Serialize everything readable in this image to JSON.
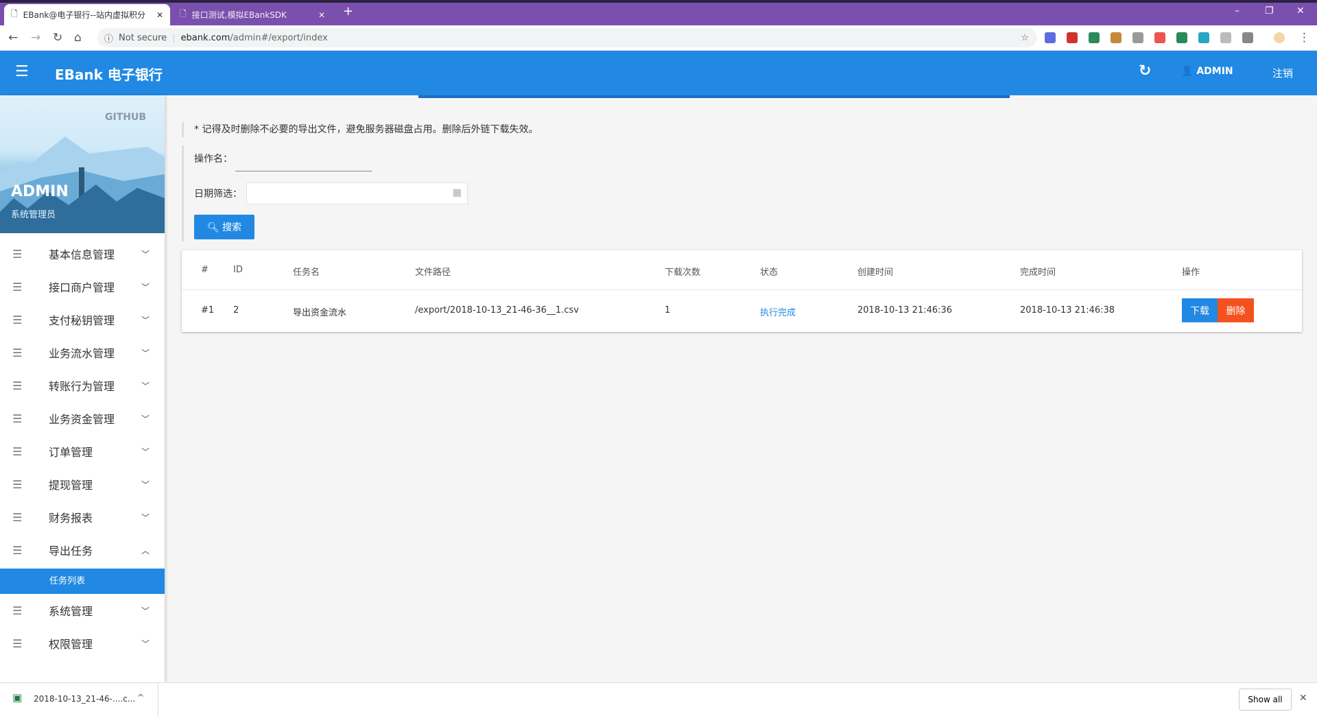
{
  "browser": {
    "tabs": [
      {
        "title": "EBank@电子银行--站内虚拟积分",
        "active": true
      },
      {
        "title": "接口测试,模拟EBankSDK",
        "active": false
      }
    ],
    "new_tab": "+",
    "security": "Not secure",
    "url_host": "ebank.com",
    "url_path": "/admin#/export/index",
    "extensions": [
      {
        "name": "JH",
        "color": "#5b6ee1"
      },
      {
        "name": "FE",
        "color": "#d0342c"
      },
      {
        "name": "vue",
        "color": "#2c8a5a"
      },
      {
        "name": "cookie",
        "color": "#c48a3a"
      },
      {
        "name": "RP",
        "color": "#999999"
      },
      {
        "name": "infinity",
        "color": "#ef5350"
      },
      {
        "name": "vue2",
        "color": "#2c8a5a"
      },
      {
        "name": "translate",
        "color": "#26a6c7"
      },
      {
        "name": "qr",
        "color": "#bbbbbb"
      },
      {
        "name": "cast",
        "color": "#888888"
      }
    ]
  },
  "app": {
    "title": "EBank 电子银行",
    "user": "ADMIN",
    "logout": "注销"
  },
  "sidebar": {
    "github": "GITHUB",
    "user_name": "ADMIN",
    "user_role": "系统管理员",
    "items": [
      {
        "label": "基本信息管理",
        "expanded": false
      },
      {
        "label": "接口商户管理",
        "expanded": false
      },
      {
        "label": "支付秘钥管理",
        "expanded": false
      },
      {
        "label": "业务流水管理",
        "expanded": false
      },
      {
        "label": "转账行为管理",
        "expanded": false
      },
      {
        "label": "业务资金管理",
        "expanded": false
      },
      {
        "label": "订单管理",
        "expanded": false
      },
      {
        "label": "提现管理",
        "expanded": false
      },
      {
        "label": "财务报表",
        "expanded": false
      },
      {
        "label": "导出任务",
        "expanded": true
      },
      {
        "label": "系统管理",
        "expanded": false
      },
      {
        "label": "权限管理",
        "expanded": false
      }
    ],
    "active_sub": "任务列表"
  },
  "main": {
    "notice": "* 记得及时删除不必要的导出文件，避免服务器磁盘占用。删除后外链下载失效。",
    "op_name_label": "操作名：",
    "op_name_value": "",
    "date_label": "日期筛选：",
    "date_value": "",
    "search_label": "搜索",
    "columns": [
      "#",
      "ID",
      "任务名",
      "文件路径",
      "下载次数",
      "状态",
      "创建时间",
      "完成时间",
      "操作"
    ],
    "rows": [
      {
        "idx": "#1",
        "id": "2",
        "name": "导出资金流水",
        "path": "/export/2018-10-13_21-46-36__1.csv",
        "downloads": "1",
        "status": "执行完成",
        "created": "2018-10-13 21:46:36",
        "finished": "2018-10-13 21:46:38",
        "download_label": "下载",
        "delete_label": "删除"
      }
    ]
  },
  "download_bar": {
    "file": "2018-10-13_21-46-....c...",
    "show_all": "Show all"
  }
}
